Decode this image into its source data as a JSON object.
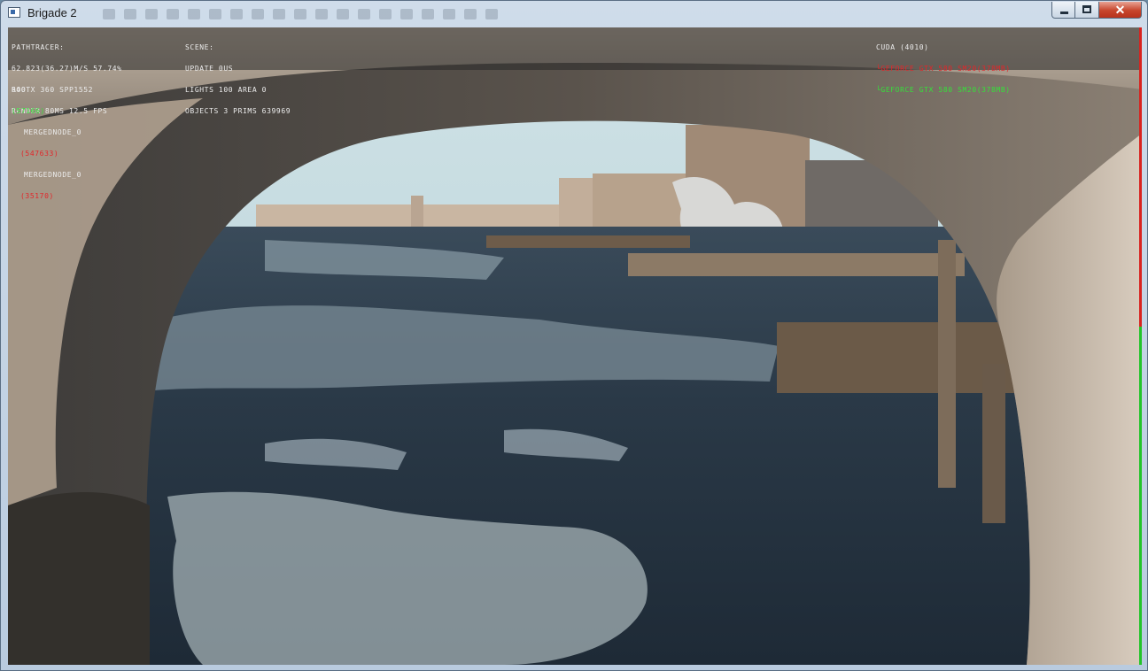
{
  "window": {
    "title": "Brigade 2",
    "close_glyph": "✕"
  },
  "hud": {
    "pathtracer": {
      "heading": "PATHTRACER:",
      "line1": "62.823(36.27)M/S 57.74%",
      "line2": "640 X 360 SPP1552",
      "line3": "RENDER 80MS 12.5 FPS"
    },
    "scene": {
      "heading": "SCENE:",
      "line1": "UPDATE 0US",
      "line2": "LIGHTS 100 AREA 0",
      "line3": "OBJECTS 3 PRIMS 639969"
    },
    "devices": {
      "heading": "CUDA (4010)",
      "gpu1": "└GEFORCE GTX 580 SM20(378MB)",
      "gpu2": "└GEFORCE GTX 580 SM20(378MB)"
    },
    "tree": {
      "root": "ROOT",
      "root_count": "(57166)",
      "node1": "MERGEDNODE_0",
      "node1_count": "(547633)",
      "node2": "MERGEDNODE_0",
      "node2_count": "(35170)"
    }
  },
  "progress": {
    "red_fraction": 0.47,
    "colors": {
      "red": "#d8231f",
      "green": "#22c42a"
    }
  },
  "icons": [
    "app-icon",
    "minimize-icon",
    "maximize-icon",
    "close-icon"
  ]
}
